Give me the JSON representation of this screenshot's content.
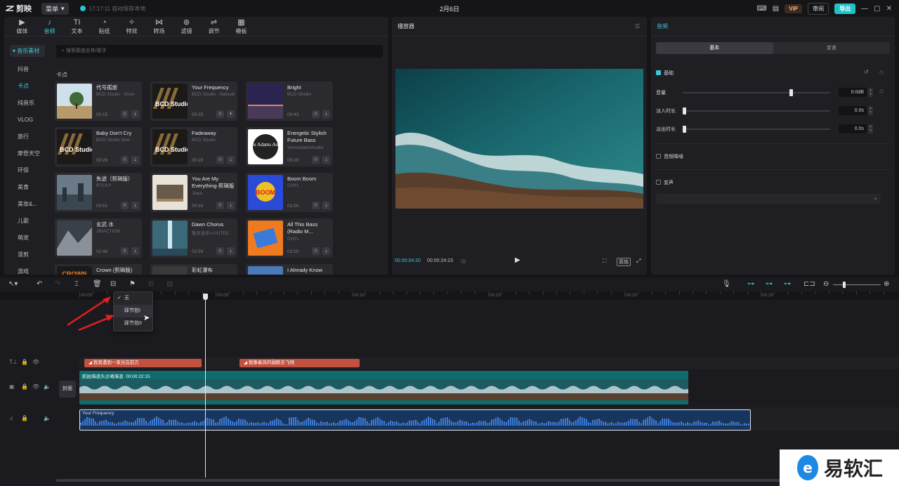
{
  "titlebar": {
    "app_name": "剪映",
    "menu_label": "菜单",
    "save_status": "17:17:11 自动保存本地",
    "doc_title": "2月6日",
    "vip_label": "VIP",
    "review_label": "审阅",
    "export_label": "导出"
  },
  "media": {
    "tabs": [
      {
        "label": "媒体",
        "icon": "media-icon"
      },
      {
        "label": "音频",
        "icon": "audio-icon"
      },
      {
        "label": "文本",
        "icon": "text-icon"
      },
      {
        "label": "贴纸",
        "icon": "sticker-icon"
      },
      {
        "label": "特效",
        "icon": "effects-icon"
      },
      {
        "label": "转场",
        "icon": "transition-icon"
      },
      {
        "label": "滤镜",
        "icon": "filter-icon"
      },
      {
        "label": "调节",
        "icon": "adjust-icon"
      },
      {
        "label": "模板",
        "icon": "template-icon"
      }
    ],
    "active_tab": "音频",
    "sidebar_header": "▾ 音乐素材",
    "sidebar_items": [
      "抖音",
      "卡点",
      "纯音乐",
      "VLOG",
      "旅行",
      "摩登天空",
      "环保",
      "美食",
      "美妆&...",
      "儿歌",
      "萌宠",
      "混剪",
      "游戏"
    ],
    "active_sidebar": "卡点",
    "search_placeholder": "搜索歌曲名称/歌手",
    "section_title": "卡点",
    "cards": [
      {
        "title": "代号孤旅",
        "sub": "BCD Studio - Oran",
        "dur": "00:15"
      },
      {
        "title": "Your Frequency",
        "sub": "BCD Studio - Natsuki",
        "dur": "00:25"
      },
      {
        "title": "Bright",
        "sub": "BCD Studio",
        "dur": "00:43"
      },
      {
        "title": "Baby Don't Cry",
        "sub": "BCD Studio 9ver",
        "dur": "00:26"
      },
      {
        "title": "Fadeaway",
        "sub": "BCD Studio",
        "dur": "00:20"
      },
      {
        "title": "Energetic Stylish Future Bass",
        "sub": "VensAdamsAudio",
        "dur": "00:29"
      },
      {
        "title": "失滤（剪辑版）",
        "sub": "R7CKY",
        "dur": "00:51"
      },
      {
        "title": "You Are My Everything-剪辑版",
        "sub": "Jiaye",
        "dur": "00:30"
      },
      {
        "title": "Boom Boom",
        "sub": "CHYL",
        "dur": "01:00"
      },
      {
        "title": "玄武·水",
        "sub": "JINACTION",
        "dur": "02:46"
      },
      {
        "title": "Dawn Chorus",
        "sub": "歌天音乐+AXITEE",
        "dur": "02:59"
      },
      {
        "title": "All This Bass (Radio M...",
        "sub": "CHYL",
        "dur": "03:20"
      },
      {
        "title": "Crown (剪辑版)",
        "sub": "",
        "dur": ""
      },
      {
        "title": "彩虹瀑布",
        "sub": "",
        "dur": ""
      },
      {
        "title": "I Already Know",
        "sub": "",
        "dur": ""
      }
    ],
    "thumb_texts": {
      "bcd": "BCD Studio",
      "vens": "Vens Adams Audio",
      "boom": "BOOM",
      "crown": "CROWN"
    }
  },
  "player": {
    "title": "播放器",
    "time_current": "00:00:04:20",
    "time_total": "00:00:24:23",
    "ratio_label": "原始"
  },
  "props": {
    "title": "音频",
    "seg_tabs": [
      "基本",
      "变速"
    ],
    "basic_label": "基础",
    "volume_label": "音量",
    "volume_value": "0.0dB",
    "volume_level": 0.74,
    "fadein_label": "淡入时长",
    "fadein_value": "0.0s",
    "fadeout_label": "淡出时长",
    "fadeout_value": "0.0s",
    "denoise_label": "音频降噪",
    "voice_change_label": "变声"
  },
  "timeline": {
    "ruler": [
      "00:00",
      "00:05",
      "00:10",
      "00:15",
      "00:20",
      "00:25"
    ],
    "dropdown": [
      "无",
      "踩节拍I",
      "踩节拍II"
    ],
    "text_clips": [
      "我曾遇到一束光在前方",
      "我像着风的翅膀去飞翔"
    ],
    "video_clip_label": "航拍海浪头沙滩海浪",
    "video_clip_duration": "00:00:22:15",
    "audio_clip_label": "Your Frequency",
    "cover_label": "封面"
  },
  "watermark": {
    "text": "易软汇"
  },
  "colors": {
    "accent": "#3cc7d6",
    "export": "#22c0c8",
    "text_clip": "#c2513f",
    "video_clip": "#0f6b6e",
    "audio_clip": "#163660"
  }
}
